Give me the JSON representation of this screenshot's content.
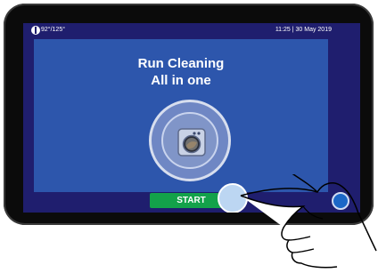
{
  "status": {
    "temperature": "92°/125°",
    "datetime": "11:25 | 30 May 2019",
    "power_icon": "power-icon"
  },
  "program": {
    "title_line1": "Run Cleaning",
    "title_line2": "All in one",
    "icon": "washer-icon"
  },
  "actions": {
    "start_label": "START"
  },
  "decor": {
    "hand_icon": "hand-pointer-icon"
  },
  "colors": {
    "panel": "#2d56ac",
    "frame": "#1f1e6e",
    "start": "#13a24a"
  }
}
